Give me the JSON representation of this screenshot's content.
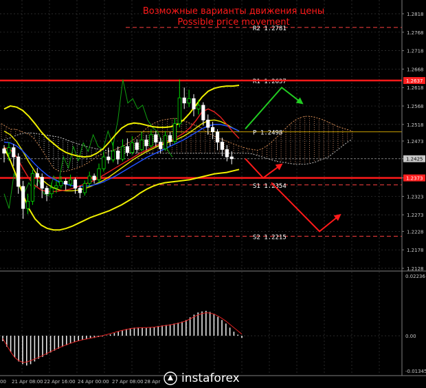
{
  "chart_data": {
    "type": "candlestick",
    "title": "Возможные варианты движения цены",
    "subtitle": "Possible price movement",
    "price_axis": {
      "range": [
        1.2128,
        1.2818
      ],
      "ticks": [
        "1.2818",
        "1.2768",
        "1.2718",
        "1.2668",
        "1.2618",
        "1.2568",
        "1.2518",
        "1.2473",
        "1.2425",
        "1.2373",
        "1.2323",
        "1.2273",
        "1.2228",
        "1.2178",
        "1.2128"
      ],
      "highlighted": [
        {
          "label": "1.2637",
          "color": "#ff2020"
        },
        {
          "label": "1.2425",
          "color": "#c8c8c8"
        },
        {
          "label": "1.2373",
          "color": "#ff2020"
        }
      ]
    },
    "levels": [
      {
        "name": "R2",
        "label": "R2 1.2781",
        "value": 1.2781,
        "style": "dashed",
        "color": "#ff4040"
      },
      {
        "name": "R1",
        "label": "R1 1.2637",
        "value": 1.2637,
        "style": "dashed",
        "color": "#ff4040"
      },
      {
        "name": "P",
        "label": "P 1.2498",
        "value": 1.2498,
        "style": "solid",
        "color": "#c8a000"
      },
      {
        "name": "S1",
        "label": "S1 1.2354",
        "value": 1.2354,
        "style": "dashed",
        "color": "#ff4040"
      },
      {
        "name": "S2",
        "label": "S2 1.2215",
        "value": 1.2215,
        "style": "dashed",
        "color": "#ff4040"
      }
    ],
    "support_resistance": [
      {
        "value": 1.2637,
        "color": "#ff1a1a"
      },
      {
        "value": 1.2373,
        "color": "#ff1a1a"
      }
    ],
    "current_price": 1.2425,
    "time_axis": [
      "21 Apr 08:00",
      "22 Apr 16:00",
      "24 Apr 00:00",
      "27 Apr 08:00",
      "28 Apr"
    ],
    "time_axis_partial": "00",
    "scenarios": [
      {
        "color": "#22cc22",
        "points": [
          [
            1.2506,
            0
          ],
          [
            1.2618,
            1
          ],
          [
            1.2575,
            2
          ]
        ]
      },
      {
        "color": "#ff1a1a",
        "points": [
          [
            1.2425,
            0
          ],
          [
            1.2373,
            1
          ],
          [
            1.241,
            2
          ]
        ]
      },
      {
        "color": "#ff1a1a",
        "points": [
          [
            1.236,
            0
          ],
          [
            1.2228,
            1
          ],
          [
            1.2273,
            2
          ]
        ]
      }
    ],
    "oscillator": {
      "type": "macd",
      "ticks": [
        "0.02236",
        "0.00",
        "-0.01345"
      ],
      "range": [
        -0.01345,
        0.02236
      ],
      "histogram": [
        -0.002,
        -0.004,
        -0.006,
        -0.008,
        -0.0095,
        -0.0105,
        -0.011,
        -0.0105,
        -0.0095,
        -0.0085,
        -0.0078,
        -0.007,
        -0.0062,
        -0.0055,
        -0.0048,
        -0.0041,
        -0.0035,
        -0.0029,
        -0.0024,
        -0.002,
        -0.0016,
        -0.0013,
        -0.001,
        -0.0008,
        -0.0005,
        -0.0003,
        0.0001,
        0.0005,
        0.001,
        0.0015,
        0.002,
        0.0025,
        0.0028,
        0.003,
        0.0031,
        0.003,
        0.0029,
        0.003,
        0.0033,
        0.0036,
        0.0038,
        0.004,
        0.0042,
        0.0045,
        0.0048,
        0.0052,
        0.0058,
        0.0068,
        0.0078,
        0.0086,
        0.009,
        0.0092,
        0.0088,
        0.008,
        0.007,
        0.0058,
        0.0045,
        0.003,
        0.0015,
        0.0004,
        -0.0008
      ],
      "signal": [
        -0.001,
        -0.0035,
        -0.006,
        -0.008,
        -0.0092,
        -0.0098,
        -0.0097,
        -0.0092,
        -0.0086,
        -0.008,
        -0.0073,
        -0.0066,
        -0.0059,
        -0.0052,
        -0.0045,
        -0.0039,
        -0.0033,
        -0.0028,
        -0.0023,
        -0.0019,
        -0.0015,
        -0.0012,
        -0.0009,
        -0.0006,
        -0.0003,
        0.0,
        0.0004,
        0.0008,
        0.0012,
        0.0016,
        0.002,
        0.0023,
        0.0026,
        0.0028,
        0.0029,
        0.003,
        0.003,
        0.0031,
        0.0032,
        0.0034,
        0.0036,
        0.0038,
        0.004,
        0.0043,
        0.0046,
        0.005,
        0.0055,
        0.0062,
        0.007,
        0.0077,
        0.0082,
        0.0085,
        0.0084,
        0.008,
        0.0073,
        0.0064,
        0.0054,
        0.0042,
        0.003,
        0.0018,
        0.0006
      ]
    },
    "candles": [
      [
        1.2452,
        1.244,
        1.2462,
        1.2415
      ],
      [
        1.244,
        1.2455,
        1.247,
        1.242
      ],
      [
        1.2455,
        1.243,
        1.2465,
        1.2405
      ],
      [
        1.243,
        1.235,
        1.244,
        1.233
      ],
      [
        1.235,
        1.229,
        1.2365,
        1.2262
      ],
      [
        1.229,
        1.231,
        1.233,
        1.2275
      ],
      [
        1.231,
        1.2385,
        1.2395,
        1.23
      ],
      [
        1.2385,
        1.2375,
        1.24,
        1.235
      ],
      [
        1.2375,
        1.2345,
        1.2385,
        1.2318
      ],
      [
        1.2345,
        1.233,
        1.2352,
        1.231
      ],
      [
        1.233,
        1.2346,
        1.236,
        1.2318
      ],
      [
        1.2346,
        1.2352,
        1.2365,
        1.2332
      ],
      [
        1.2352,
        1.2364,
        1.2378,
        1.2345
      ],
      [
        1.2364,
        1.2356,
        1.2372,
        1.234
      ],
      [
        1.2356,
        1.2368,
        1.2382,
        1.235
      ],
      [
        1.2368,
        1.2345,
        1.2374,
        1.233
      ],
      [
        1.2345,
        1.2333,
        1.2352,
        1.2318
      ],
      [
        1.2333,
        1.2358,
        1.2366,
        1.2325
      ],
      [
        1.2358,
        1.2378,
        1.239,
        1.235
      ],
      [
        1.2378,
        1.2368,
        1.2385,
        1.2358
      ],
      [
        1.2368,
        1.2398,
        1.2412,
        1.236
      ],
      [
        1.2398,
        1.243,
        1.2445,
        1.239
      ],
      [
        1.243,
        1.2422,
        1.2455,
        1.2412
      ],
      [
        1.2422,
        1.2446,
        1.247,
        1.2415
      ],
      [
        1.2446,
        1.2424,
        1.2458,
        1.241
      ],
      [
        1.2424,
        1.2458,
        1.2478,
        1.2418
      ],
      [
        1.2458,
        1.2442,
        1.248,
        1.2432
      ],
      [
        1.2442,
        1.2468,
        1.2486,
        1.2436
      ],
      [
        1.2468,
        1.245,
        1.2478,
        1.244
      ],
      [
        1.245,
        1.2476,
        1.2498,
        1.2445
      ],
      [
        1.2476,
        1.246,
        1.249,
        1.2448
      ],
      [
        1.246,
        1.249,
        1.2505,
        1.2455
      ],
      [
        1.249,
        1.247,
        1.25,
        1.2458
      ],
      [
        1.247,
        1.2452,
        1.2482,
        1.244
      ],
      [
        1.2452,
        1.2488,
        1.25,
        1.2446
      ],
      [
        1.2488,
        1.2472,
        1.2498,
        1.246
      ],
      [
        1.2472,
        1.252,
        1.2535,
        1.2465
      ],
      [
        1.252,
        1.259,
        1.264,
        1.251
      ],
      [
        1.259,
        1.2576,
        1.2618,
        1.256
      ],
      [
        1.2576,
        1.2588,
        1.2612,
        1.2565
      ],
      [
        1.2588,
        1.256,
        1.26,
        1.254
      ],
      [
        1.256,
        1.257,
        1.2585,
        1.2545
      ],
      [
        1.257,
        1.253,
        1.2578,
        1.2515
      ],
      [
        1.253,
        1.251,
        1.2545,
        1.249
      ],
      [
        1.251,
        1.2498,
        1.2525,
        1.2478
      ],
      [
        1.2498,
        1.247,
        1.2505,
        1.2448
      ],
      [
        1.247,
        1.245,
        1.2482,
        1.2432
      ],
      [
        1.245,
        1.243,
        1.2462,
        1.2418
      ],
      [
        1.243,
        1.2425,
        1.2445,
        1.241
      ]
    ],
    "indicators": {
      "bb_upper": [
        1.256,
        1.2568,
        1.2565,
        1.2556,
        1.254,
        1.252,
        1.2498,
        1.248,
        1.2466,
        1.2452,
        1.2442,
        1.2436,
        1.2432,
        1.243,
        1.2432,
        1.244,
        1.2452,
        1.247,
        1.249,
        1.2508,
        1.2518,
        1.2522,
        1.252,
        1.2516,
        1.2512,
        1.251,
        1.251,
        1.2512,
        1.2518,
        1.253,
        1.2548,
        1.257,
        1.2592,
        1.2608,
        1.2616,
        1.262,
        1.2622,
        1.2622,
        1.2624
      ],
      "bb_lower": [
        1.2455,
        1.242,
        1.2378,
        1.233,
        1.229,
        1.2262,
        1.2245,
        1.2236,
        1.2232,
        1.2232,
        1.2236,
        1.2242,
        1.225,
        1.2258,
        1.2266,
        1.2272,
        1.2278,
        1.2284,
        1.2292,
        1.23,
        1.231,
        1.232,
        1.2332,
        1.2342,
        1.235,
        1.2356,
        1.236,
        1.2362,
        1.2364,
        1.2366,
        1.2368,
        1.2372,
        1.2376,
        1.238,
        1.2384,
        1.2386,
        1.2388,
        1.2392,
        1.2396
      ],
      "bb_mid": [
        1.25,
        1.249,
        1.2472,
        1.2446,
        1.2416,
        1.239,
        1.237,
        1.2356,
        1.2346,
        1.234,
        1.2338,
        1.2338,
        1.234,
        1.2344,
        1.235,
        1.2358,
        1.2366,
        1.2376,
        1.2388,
        1.24,
        1.2412,
        1.2424,
        1.2434,
        1.2444,
        1.2452,
        1.246,
        1.2466,
        1.2472,
        1.2478,
        1.2486,
        1.2496,
        1.2508,
        1.252,
        1.2528,
        1.253,
        1.2526,
        1.2518,
        1.2508,
        1.25
      ],
      "ma_red": [
        1.2455,
        1.245,
        1.243,
        1.24,
        1.2372,
        1.2352,
        1.234,
        1.2336,
        1.2336,
        1.2338,
        1.234,
        1.2344,
        1.235,
        1.2356,
        1.2362,
        1.237,
        1.238,
        1.239,
        1.24,
        1.241,
        1.242,
        1.243,
        1.244,
        1.2448,
        1.2456,
        1.2464,
        1.247,
        1.2476,
        1.2484,
        1.2494,
        1.2508,
        1.2528,
        1.2552,
        1.256,
        1.2552,
        1.2538,
        1.2518,
        1.2498,
        1.248
      ],
      "ma_blue": [
        1.247,
        1.2468,
        1.246,
        1.2446,
        1.2428,
        1.241,
        1.2394,
        1.238,
        1.237,
        1.2362,
        1.2356,
        1.2352,
        1.235,
        1.235,
        1.2352,
        1.2356,
        1.2362,
        1.237,
        1.2378,
        1.2388,
        1.2398,
        1.2408,
        1.2418,
        1.2428,
        1.2436,
        1.2444,
        1.2452,
        1.246,
        1.2468,
        1.2476,
        1.2486,
        1.2496,
        1.2506,
        1.2514,
        1.2518,
        1.2518,
        1.2514,
        1.2508,
        1.25
      ],
      "chikou": [
        1.233,
        1.229,
        1.2385,
        1.235,
        1.233,
        1.236,
        1.234,
        1.2368,
        1.233,
        1.2325,
        1.2378,
        1.236,
        1.243,
        1.24,
        1.2458,
        1.242,
        1.2468,
        1.2445,
        1.249,
        1.2458,
        1.245,
        1.25,
        1.246,
        1.253,
        1.264,
        1.2576,
        1.2588,
        1.256,
        1.257,
        1.253,
        1.251,
        1.2498,
        1.247,
        1.245,
        1.243
      ],
      "cloud_a": [
        1.252,
        1.2512,
        1.2505,
        1.2505,
        1.25,
        1.2495,
        1.249,
        1.2478,
        1.246,
        1.244,
        1.242,
        1.24,
        1.2392,
        1.239,
        1.2392,
        1.2396,
        1.24,
        1.2405,
        1.2412,
        1.242,
        1.243,
        1.2436,
        1.244,
        1.2446,
        1.245,
        1.2456,
        1.2462,
        1.247,
        1.2478,
        1.2488,
        1.25,
        1.2512,
        1.252,
        1.2526,
        1.253,
        1.2532,
        1.2534,
        1.2534,
        1.253,
        1.2525,
        1.252,
        1.2515,
        1.251,
        1.25,
        1.2492,
        1.2486,
        1.248,
        1.2475,
        1.247,
        1.2465,
        1.246,
        1.2456,
        1.2452,
        1.245,
        1.2448,
        1.2452,
        1.246,
        1.247,
        1.2482,
        1.2495,
        1.2508,
        1.252,
        1.253,
        1.2536,
        1.254,
        1.254,
        1.2538,
        1.2534,
        1.253,
        1.2524,
        1.2518,
        1.2512,
        1.2508,
        1.2504,
        1.25
      ],
      "cloud_b": [
        1.2475,
        1.2478,
        1.2482,
        1.2488,
        1.2492,
        1.2495,
        1.2495,
        1.2494,
        1.2492,
        1.249,
        1.2488,
        1.2486,
        1.2484,
        1.248,
        1.2475,
        1.247,
        1.2466,
        1.2462,
        1.2458,
        1.2455,
        1.2452,
        1.245,
        1.2448,
        1.2446,
        1.2444,
        1.2442,
        1.244,
        1.244,
        1.244,
        1.244,
        1.244,
        1.244,
        1.244,
        1.244,
        1.244,
        1.244,
        1.244,
        1.244,
        1.244,
        1.244,
        1.244,
        1.244,
        1.244,
        1.244,
        1.244,
        1.244,
        1.244,
        1.244,
        1.244,
        1.244,
        1.244,
        1.244,
        1.244,
        1.2438,
        1.2434,
        1.243,
        1.2426,
        1.2422,
        1.2418,
        1.2416,
        1.2414,
        1.2412,
        1.241,
        1.241,
        1.241,
        1.2412,
        1.2415,
        1.242,
        1.2425,
        1.243,
        1.244,
        1.245,
        1.246,
        1.247,
        1.2478
      ]
    },
    "logo_text": "instaforex"
  }
}
